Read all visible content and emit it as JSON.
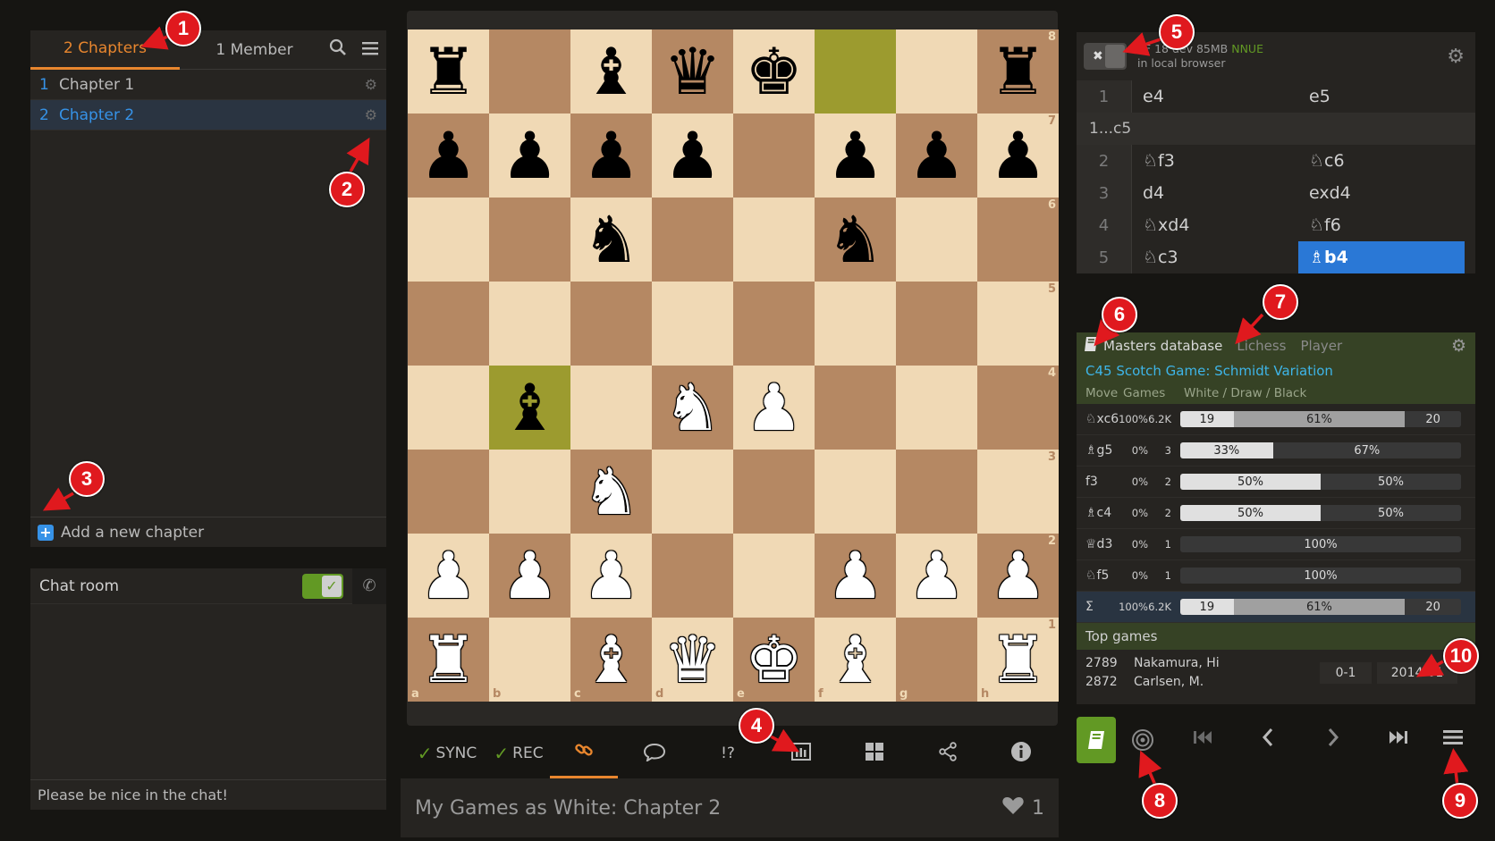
{
  "chapters": {
    "tab_chapters": "2 Chapters",
    "tab_members": "1 Member",
    "items": [
      {
        "num": "1",
        "label": "Chapter 1"
      },
      {
        "num": "2",
        "label": "Chapter 2"
      }
    ],
    "add_label": "Add a new chapter"
  },
  "chat": {
    "title": "Chat room",
    "footer": "Please be nice in the chat!"
  },
  "board": {
    "ranks": [
      "8",
      "7",
      "6",
      "5",
      "4",
      "3",
      "2",
      "1"
    ],
    "files": [
      "a",
      "b",
      "c",
      "d",
      "e",
      "f",
      "g",
      "h"
    ],
    "position": [
      [
        "bR",
        "",
        "bB",
        "bQ",
        "bK",
        "",
        "",
        "bR"
      ],
      [
        "bP",
        "bP",
        "bP",
        "bP",
        "",
        "bP",
        "bP",
        "bP"
      ],
      [
        "",
        "",
        "bN",
        "",
        "",
        "bN",
        "",
        ""
      ],
      [
        "",
        "",
        "",
        "",
        "",
        "",
        "",
        ""
      ],
      [
        "",
        "bB",
        "",
        "wN",
        "wP",
        "",
        "",
        ""
      ],
      [
        "",
        "",
        "wN",
        "",
        "",
        "",
        "",
        ""
      ],
      [
        "wP",
        "wP",
        "wP",
        "",
        "",
        "wP",
        "wP",
        "wP"
      ],
      [
        "wR",
        "",
        "wB",
        "wQ",
        "wK",
        "wB",
        "",
        "wR"
      ]
    ],
    "highlight": [
      "f8",
      "b4"
    ]
  },
  "tools": {
    "sync": "SYNC",
    "rec": "REC",
    "glyphs": "!?"
  },
  "study": {
    "title": "My Games as White: Chapter 2",
    "likes": "1"
  },
  "engine": {
    "name": "SF 18 dev 85MB",
    "nnue": "NNUE",
    "location": "in local browser"
  },
  "moves": {
    "rows": [
      {
        "n": "1",
        "w": "e4",
        "b": "e5"
      },
      {
        "variation": "1...c5"
      },
      {
        "n": "2",
        "w": "♘f3",
        "b": "♘c6"
      },
      {
        "n": "3",
        "w": "d4",
        "b": "exd4"
      },
      {
        "n": "4",
        "w": "♘xd4",
        "b": "♘f6"
      },
      {
        "n": "5",
        "w": "♘c3",
        "b": "♗b4"
      }
    ]
  },
  "explorer": {
    "tab_masters": "Masters database",
    "tab_lichess": "Lichess",
    "tab_player": "Player",
    "opening": "C45 Scotch Game: Schmidt Variation",
    "col_move": "Move",
    "col_games": "Games",
    "col_wdb": "White / Draw / Black",
    "rows": [
      {
        "move": "♘xc6",
        "pct": "100%",
        "games": "6.2K",
        "w": 19,
        "wl": "19",
        "d": 61,
        "dl": "61%",
        "b": 20,
        "bl": "20"
      },
      {
        "move": "♗g5",
        "pct": "0%",
        "games": "3",
        "w": 33,
        "wl": "33%",
        "d": 0,
        "dl": "",
        "b": 67,
        "bl": "67%"
      },
      {
        "move": "f3",
        "pct": "0%",
        "games": "2",
        "w": 50,
        "wl": "50%",
        "d": 0,
        "dl": "",
        "b": 50,
        "bl": "50%"
      },
      {
        "move": "♗c4",
        "pct": "0%",
        "games": "2",
        "w": 50,
        "wl": "50%",
        "d": 0,
        "dl": "",
        "b": 50,
        "bl": "50%"
      },
      {
        "move": "♕d3",
        "pct": "0%",
        "games": "1",
        "w": 0,
        "wl": "",
        "d": 0,
        "dl": "",
        "b": 100,
        "bl": "100%"
      },
      {
        "move": "♘f5",
        "pct": "0%",
        "games": "1",
        "w": 0,
        "wl": "",
        "d": 0,
        "dl": "",
        "b": 100,
        "bl": "100%"
      }
    ],
    "sum": {
      "move": "Σ",
      "pct": "100%",
      "games": "6.2K",
      "w": 19,
      "wl": "19",
      "d": 61,
      "dl": "61%",
      "b": 20,
      "bl": "20"
    },
    "top_games_title": "Top games",
    "top_game": {
      "rating_white": "2789",
      "rating_black": "2872",
      "white": "Nakamura, Hi",
      "black": "Carlsen, M.",
      "result": "0-1",
      "date": "2014-01"
    }
  },
  "annotations": [
    "1",
    "2",
    "3",
    "4",
    "5",
    "6",
    "7",
    "8",
    "9",
    "10"
  ],
  "colors": {
    "accent": "#e8862e",
    "link": "#3692e7",
    "green": "#629924",
    "annotation": "#e0191e"
  }
}
